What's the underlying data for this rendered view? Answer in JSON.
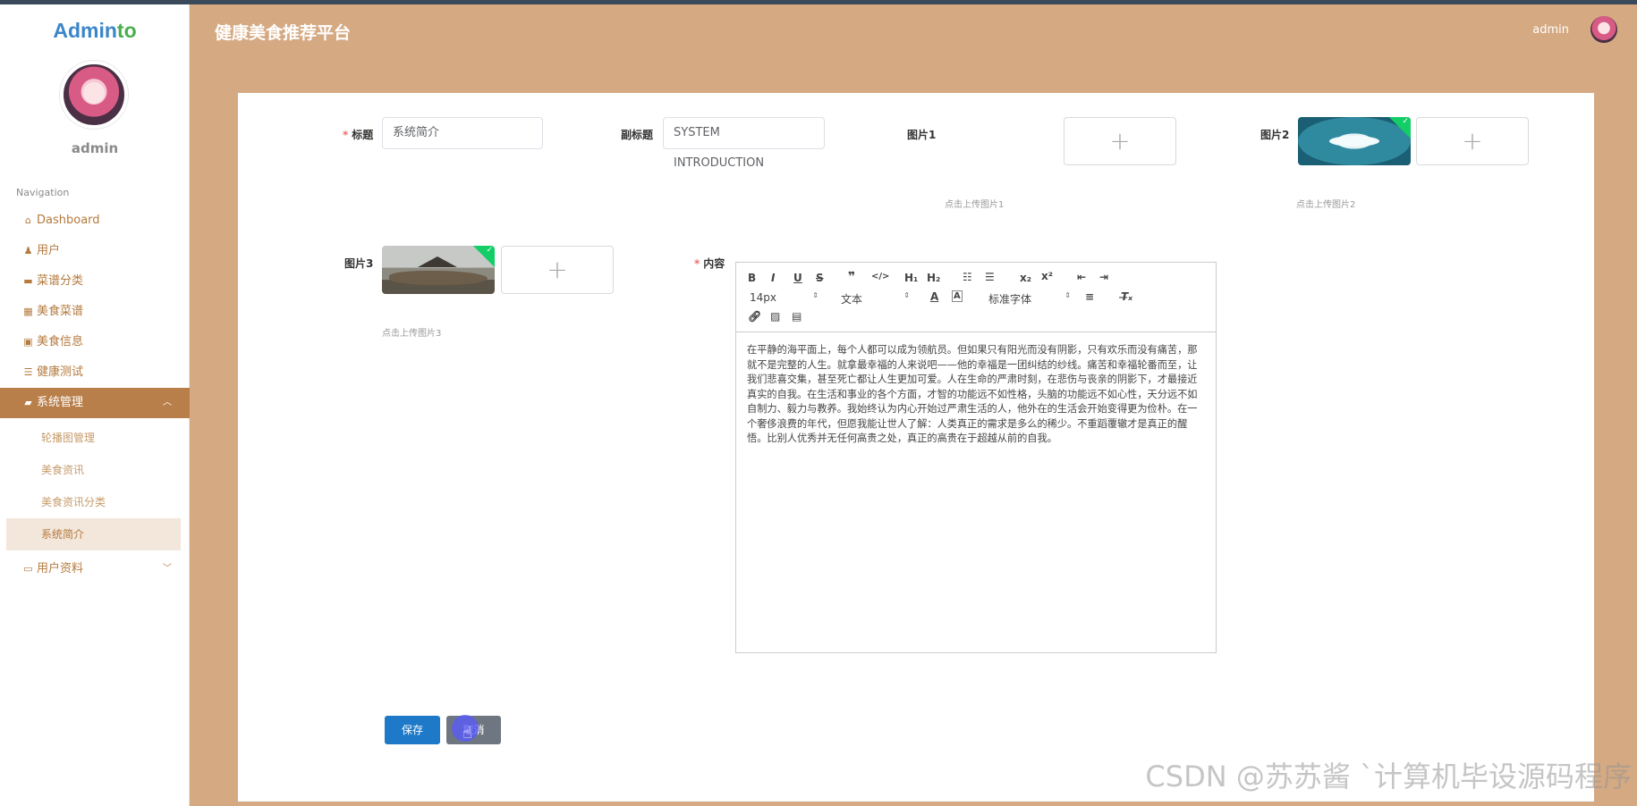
{
  "app": {
    "logo_a": "Admin",
    "logo_b": "to",
    "title": "健康美食推荐平台"
  },
  "header": {
    "user": "admin"
  },
  "sidebar": {
    "user": "admin",
    "nav_title": "Navigation",
    "items": [
      {
        "label": "Dashboard",
        "icon": "home-icon"
      },
      {
        "label": "用户",
        "icon": "user-icon"
      },
      {
        "label": "菜谱分类",
        "icon": "briefcase-icon"
      },
      {
        "label": "美食菜谱",
        "icon": "grid-icon"
      },
      {
        "label": "美食信息",
        "icon": "clipboard-icon"
      },
      {
        "label": "健康测试",
        "icon": "list-icon"
      },
      {
        "label": "系统管理",
        "icon": "chat-icon"
      }
    ],
    "sub_items": [
      "轮播图管理",
      "美食资讯",
      "美食资讯分类",
      "系统简介"
    ],
    "profile_item": "用户资料"
  },
  "form": {
    "title_label": "标题",
    "title_value": "系统简介",
    "subtitle_label": "副标题",
    "subtitle_value": "SYSTEM INTRODUCTION",
    "pic1_label": "图片1",
    "pic1_hint": "点击上传图片1",
    "pic2_label": "图片2",
    "pic2_hint": "点击上传图片2",
    "pic3_label": "图片3",
    "pic3_hint": "点击上传图片3",
    "content_label": "内容",
    "font_size": "14px",
    "paragraph_style": "文本",
    "font_family": "标准字体",
    "content": "在平静的海平面上，每个人都可以成为领航员。但如果只有阳光而没有阴影，只有欢乐而没有痛苦，那就不是完整的人生。就拿最幸福的人来说吧——他的幸福是一团纠结的纱线。痛苦和幸福轮番而至，让我们悲喜交集，甚至死亡都让人生更加可爱。人在生命的严肃时刻，在悲伤与丧亲的阴影下，才最接近真实的自我。在生活和事业的各个方面，才智的功能远不如性格，头脑的功能远不如心性，天分远不如自制力、毅力与教养。我始终认为内心开始过严肃生活的人，他外在的生活会开始变得更为俭朴。在一个奢侈浪费的年代，但愿我能让世人了解：人类真正的需求是多么的稀少。不重蹈覆辙才是真正的醒悟。比别人优秀并无任何高贵之处，真正的高贵在于超越从前的自我。",
    "save_label": "保存",
    "cancel_label": "取消"
  },
  "watermark": "CSDN @苏苏酱 `计算机毕设源码程序"
}
